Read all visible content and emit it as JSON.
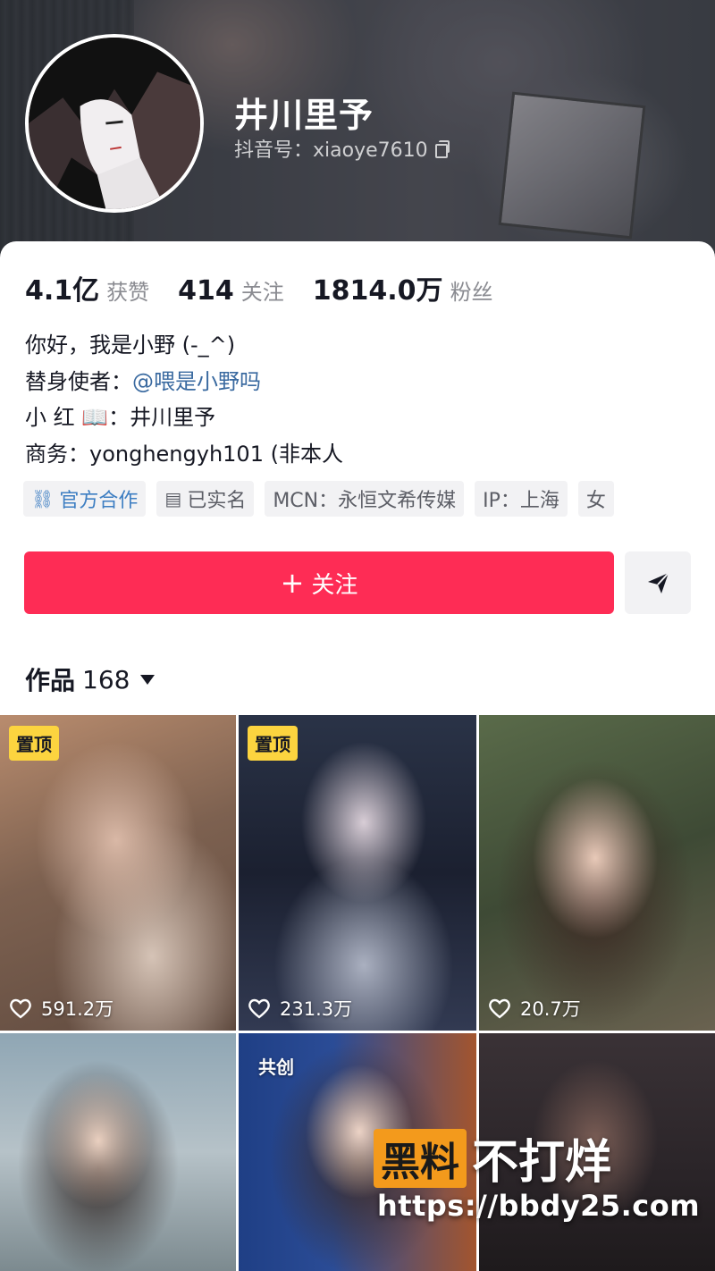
{
  "profile": {
    "name": "井川里予",
    "douyin_id": "抖音号：xiaoye7610"
  },
  "stats": [
    {
      "value": "4.1亿",
      "label": "获赞"
    },
    {
      "value": "414",
      "label": "关注"
    },
    {
      "value": "1814.0万",
      "label": "粉丝"
    }
  ],
  "bio": {
    "line1": "你好，我是小野 (-_^)",
    "line2_prefix": "替身使者：",
    "line2_mention": "@喂是小野吗",
    "line3": "小 红 📖：井川里予",
    "line4": "商务：yonghengyh101 (非本人"
  },
  "tags": [
    {
      "label": "官方合作",
      "icon": "official-cooperation-icon"
    },
    {
      "label": "已实名",
      "icon": "id-card-icon"
    },
    {
      "label": "MCN：永恒文希传媒"
    },
    {
      "label": "IP：上海"
    },
    {
      "label": "女"
    }
  ],
  "actions": {
    "follow_label": "关注",
    "send_icon": "send-icon"
  },
  "works": {
    "label": "作品",
    "count": "168"
  },
  "videos": [
    {
      "pinned": "置顶",
      "likes": "591.2万"
    },
    {
      "pinned": "置顶",
      "likes": "231.3万"
    },
    {
      "likes": "20.7万"
    },
    {},
    {
      "collab": "共创"
    },
    {}
  ],
  "watermark": {
    "box": "黑料",
    "text": "不打烊",
    "url": "https://bbdy25.com"
  },
  "colors": {
    "primary": "#fe2c55",
    "pin": "#fcd43f",
    "mention": "#3a6aa0",
    "official": "#3d7ec2"
  }
}
